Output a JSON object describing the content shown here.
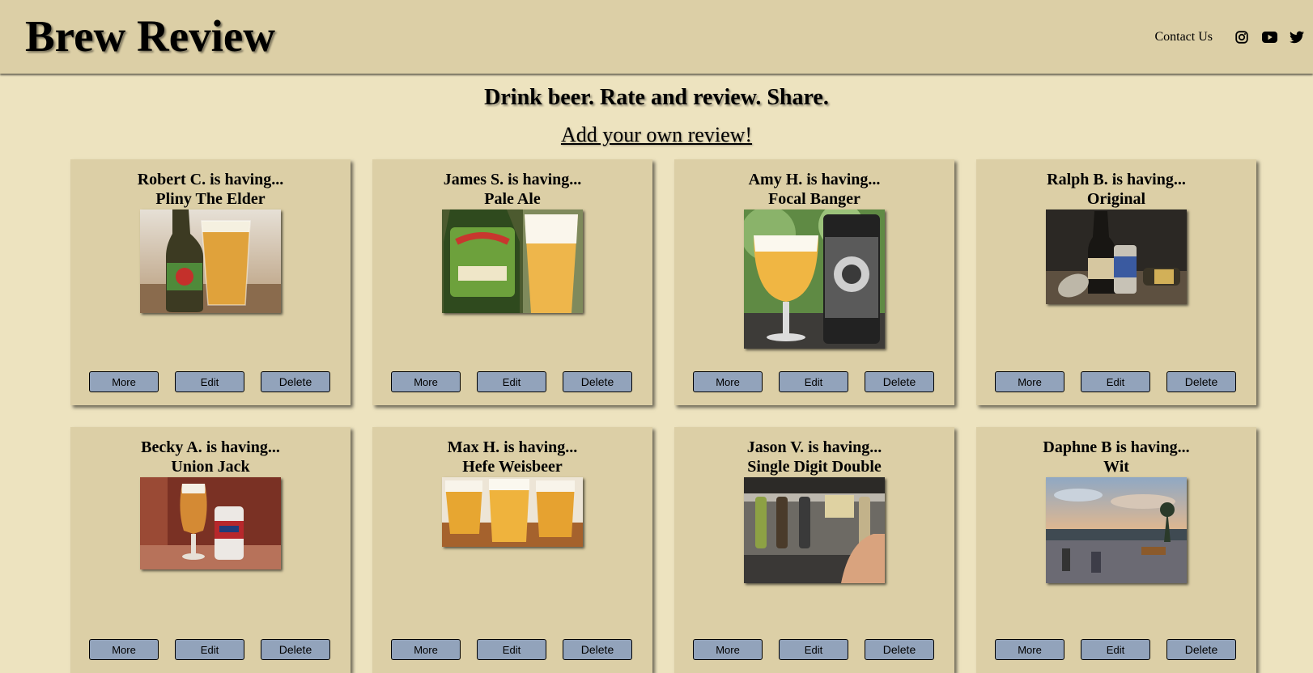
{
  "site": {
    "title": "Brew Review"
  },
  "nav": {
    "contact_label": "Contact Us",
    "icons": [
      "instagram-icon",
      "youtube-icon",
      "twitter-icon"
    ]
  },
  "hero": {
    "tagline": "Drink beer. Rate and review. Share.",
    "add_review_link": "Add your own review!"
  },
  "buttons": {
    "more": "More",
    "edit": "Edit",
    "delete": "Delete"
  },
  "reviews": [
    {
      "reviewer": "Robert C. is having...",
      "beer": "Pliny The Elder"
    },
    {
      "reviewer": "James S. is having...",
      "beer": "Pale Ale"
    },
    {
      "reviewer": "Amy H. is having...",
      "beer": "Focal Banger"
    },
    {
      "reviewer": "Ralph B. is having...",
      "beer": "Original"
    },
    {
      "reviewer": "Becky A. is having...",
      "beer": "Union Jack"
    },
    {
      "reviewer": "Max H. is having...",
      "beer": "Hefe Weisbeer"
    },
    {
      "reviewer": "Jason V. is having...",
      "beer": "Single Digit Double"
    },
    {
      "reviewer": "Daphne B is having...",
      "beer": "Wit"
    }
  ],
  "colors": {
    "page_bg": "#ede3bf",
    "header_bg": "#dccfa6",
    "card_bg": "#dccfa6",
    "button_bg": "#92a3bb"
  }
}
